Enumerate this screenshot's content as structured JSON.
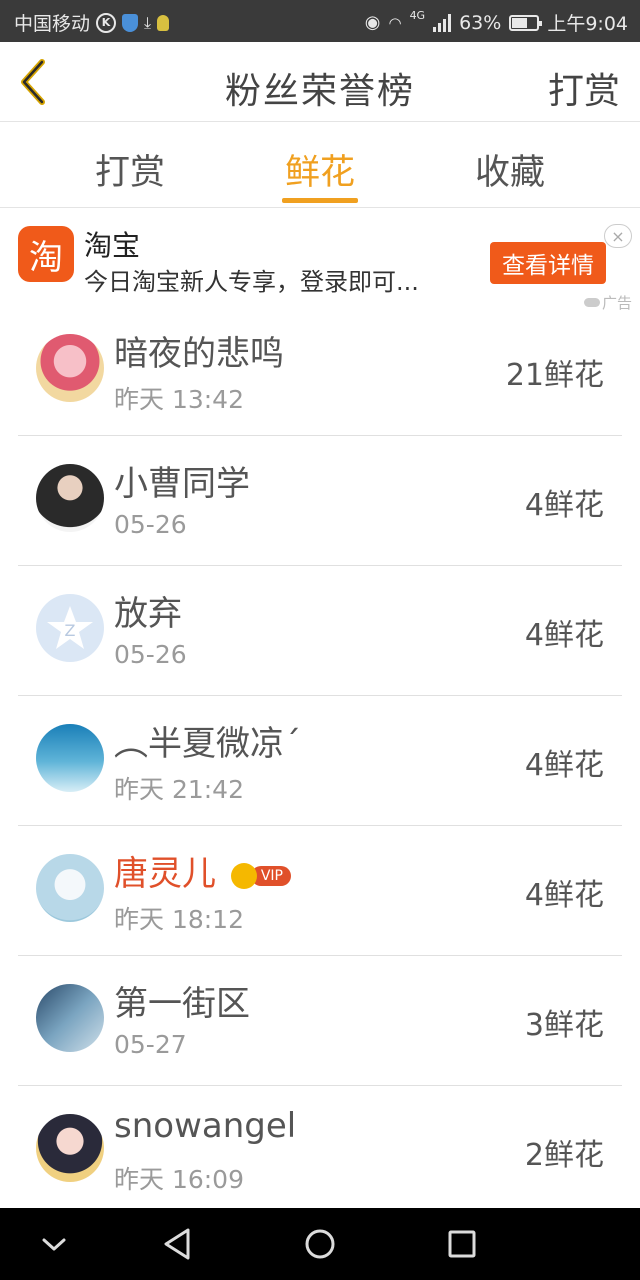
{
  "status_bar": {
    "carrier": "中国移动",
    "network": "4G",
    "battery": "63%",
    "battery_level": 0.63,
    "time": "上午9:04"
  },
  "header": {
    "title": "粉丝荣誉榜",
    "right_action": "打赏"
  },
  "tabs": [
    {
      "label": "打赏",
      "active": false
    },
    {
      "label": "鲜花",
      "active": true
    },
    {
      "label": "收藏",
      "active": false
    }
  ],
  "ad": {
    "logo_char": "淘",
    "title": "淘宝",
    "description": "今日淘宝新人专享，登录即可...",
    "button": "查看详情",
    "close": "×",
    "label": "广告"
  },
  "fans": [
    {
      "name": "暗夜的悲鸣",
      "time": "昨天 13:42",
      "count": "21鲜花",
      "vip": false
    },
    {
      "name": "小曹同学",
      "time": "05-26",
      "count": "4鲜花",
      "vip": false
    },
    {
      "name": "放弃",
      "time": "05-26",
      "count": "4鲜花",
      "vip": false
    },
    {
      "name": "︵半夏微凉ˊ",
      "time": "昨天 21:42",
      "count": "4鲜花",
      "vip": false
    },
    {
      "name": "唐灵儿",
      "time": "昨天 18:12",
      "count": "4鲜花",
      "vip": true,
      "vip_label": "VIP"
    },
    {
      "name": "第一街区",
      "time": "05-27",
      "count": "3鲜花",
      "vip": false
    },
    {
      "name": "snowangel",
      "time": "昨天 16:09",
      "count": "2鲜花",
      "vip": false
    }
  ],
  "colors": {
    "accent": "#f0a020",
    "vip_name": "#e0502a",
    "ad_orange": "#f05a1a"
  }
}
